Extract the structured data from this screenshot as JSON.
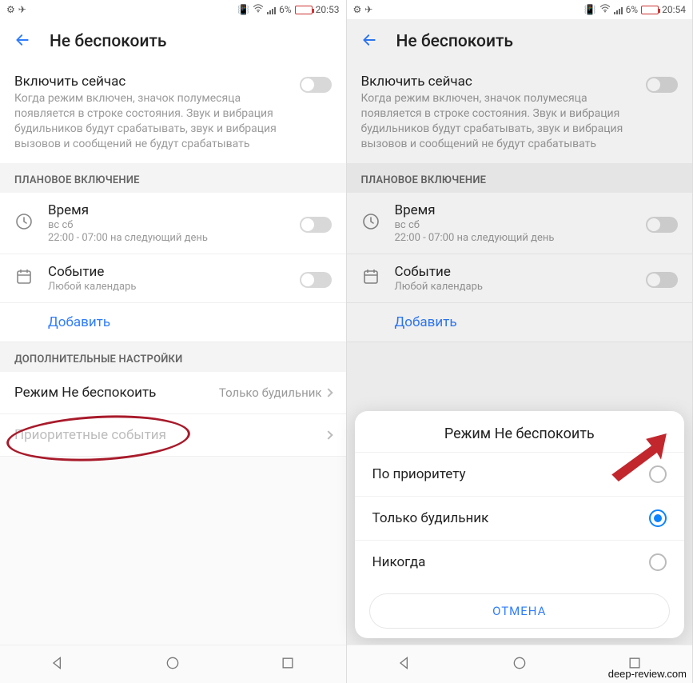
{
  "left": {
    "statusbar": {
      "battery": "6%",
      "time": "20:53"
    },
    "header": {
      "title": "Не беспокоить"
    },
    "enable": {
      "title": "Включить сейчас",
      "desc": "Когда режим включен, значок полумесяца появляется в строке состояния. Звук и вибрация будильников будут срабатывать, звук и вибрация вызовов и сообщений не будут срабатывать"
    },
    "group_scheduled": "ПЛАНОВОЕ ВКЛЮЧЕНИЕ",
    "time_row": {
      "title": "Время",
      "sub1": "вс сб",
      "sub2": "22:00 - 07:00 на следующий день"
    },
    "event_row": {
      "title": "Событие",
      "sub": "Любой календарь"
    },
    "add": "Добавить",
    "group_more": "ДОПОЛНИТЕЛЬНЫЕ НАСТРОЙКИ",
    "mode_row": {
      "label": "Режим Не беспокоить",
      "value": "Только будильник"
    },
    "priority_row": {
      "label": "Приоритетные события"
    }
  },
  "right": {
    "statusbar": {
      "battery": "6%",
      "time": "20:54"
    },
    "header": {
      "title": "Не беспокоить"
    },
    "enable": {
      "title": "Включить сейчас",
      "desc": "Когда режим включен, значок полумесяца появляется в строке состояния. Звук и вибрация будильников будут срабатывать, звук и вибрация вызовов и сообщений не будут срабатывать"
    },
    "group_scheduled": "ПЛАНОВОЕ ВКЛЮЧЕНИЕ",
    "time_row": {
      "title": "Время",
      "sub1": "вс сб",
      "sub2": "22:00 - 07:00 на следующий день"
    },
    "event_row": {
      "title": "Событие",
      "sub": "Любой календарь"
    },
    "add": "Добавить",
    "dialog": {
      "title": "Режим Не беспокоить",
      "opt1": "По приоритету",
      "opt2": "Только будильник",
      "opt3": "Никогда",
      "cancel": "ОТМЕНА"
    }
  },
  "watermark": "deep-review.com"
}
